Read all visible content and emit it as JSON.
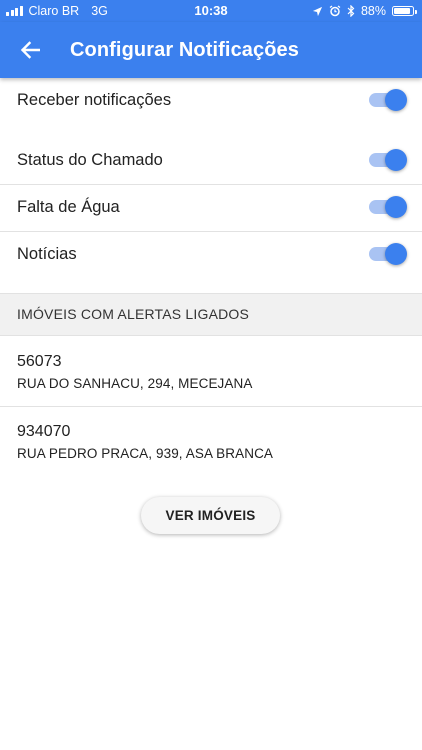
{
  "status_bar": {
    "carrier": "Claro BR",
    "network": "3G",
    "time": "10:38",
    "battery": "88%",
    "battery_level": 0.88,
    "icons": [
      "location-icon",
      "alarm-icon",
      "bluetooth-icon",
      "battery-icon"
    ]
  },
  "header": {
    "title": "Configurar Notificações",
    "back_icon": "arrow-left-icon"
  },
  "settings": {
    "master": {
      "label": "Receber notificações",
      "enabled": true
    },
    "items": [
      {
        "label": "Status do Chamado",
        "enabled": true
      },
      {
        "label": "Falta de Água",
        "enabled": true
      },
      {
        "label": "Notícias",
        "enabled": true
      }
    ]
  },
  "properties_section": {
    "title": "IMÓVEIS COM ALERTAS LIGADOS",
    "items": [
      {
        "code": "56073",
        "address": "RUA DO SANHACU, 294, MECEJANA"
      },
      {
        "code": "934070",
        "address": "RUA PEDRO PRACA, 939, ASA BRANCA"
      }
    ]
  },
  "actions": {
    "view_properties_label": "VER IMÓVEIS"
  },
  "colors": {
    "primary": "#3b80ee",
    "switch_track": "#a9c3f3",
    "section_bg": "#f1f1f1"
  }
}
